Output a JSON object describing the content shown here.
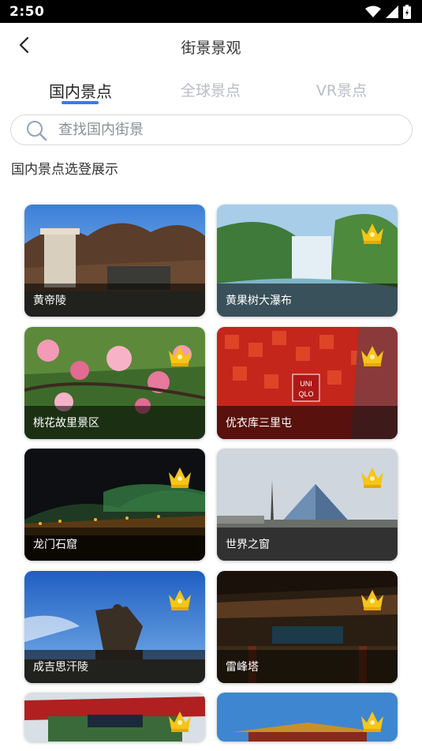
{
  "status": {
    "time": "2:50"
  },
  "header": {
    "title": "街景景观"
  },
  "tabs": [
    {
      "label": "国内景点",
      "active": true
    },
    {
      "label": "全球景点",
      "active": false
    },
    {
      "label": "VR景点",
      "active": false
    }
  ],
  "search": {
    "placeholder": "查找国内街景"
  },
  "section": {
    "title": "国内景点选登展示"
  },
  "cards": [
    {
      "label": "黄帝陵",
      "vip": false
    },
    {
      "label": "黄果树大瀑布",
      "vip": true
    },
    {
      "label": "桃花故里景区",
      "vip": true
    },
    {
      "label": "优衣库三里屯",
      "vip": true
    },
    {
      "label": "龙门石窟",
      "vip": true
    },
    {
      "label": "世界之窗",
      "vip": true
    },
    {
      "label": "成吉思汗陵",
      "vip": true
    },
    {
      "label": "雷峰塔",
      "vip": true
    },
    {
      "label": "",
      "vip": true
    },
    {
      "label": "",
      "vip": true
    }
  ],
  "colors": {
    "accent": "#2f7df6",
    "crown": "#f5c518"
  }
}
